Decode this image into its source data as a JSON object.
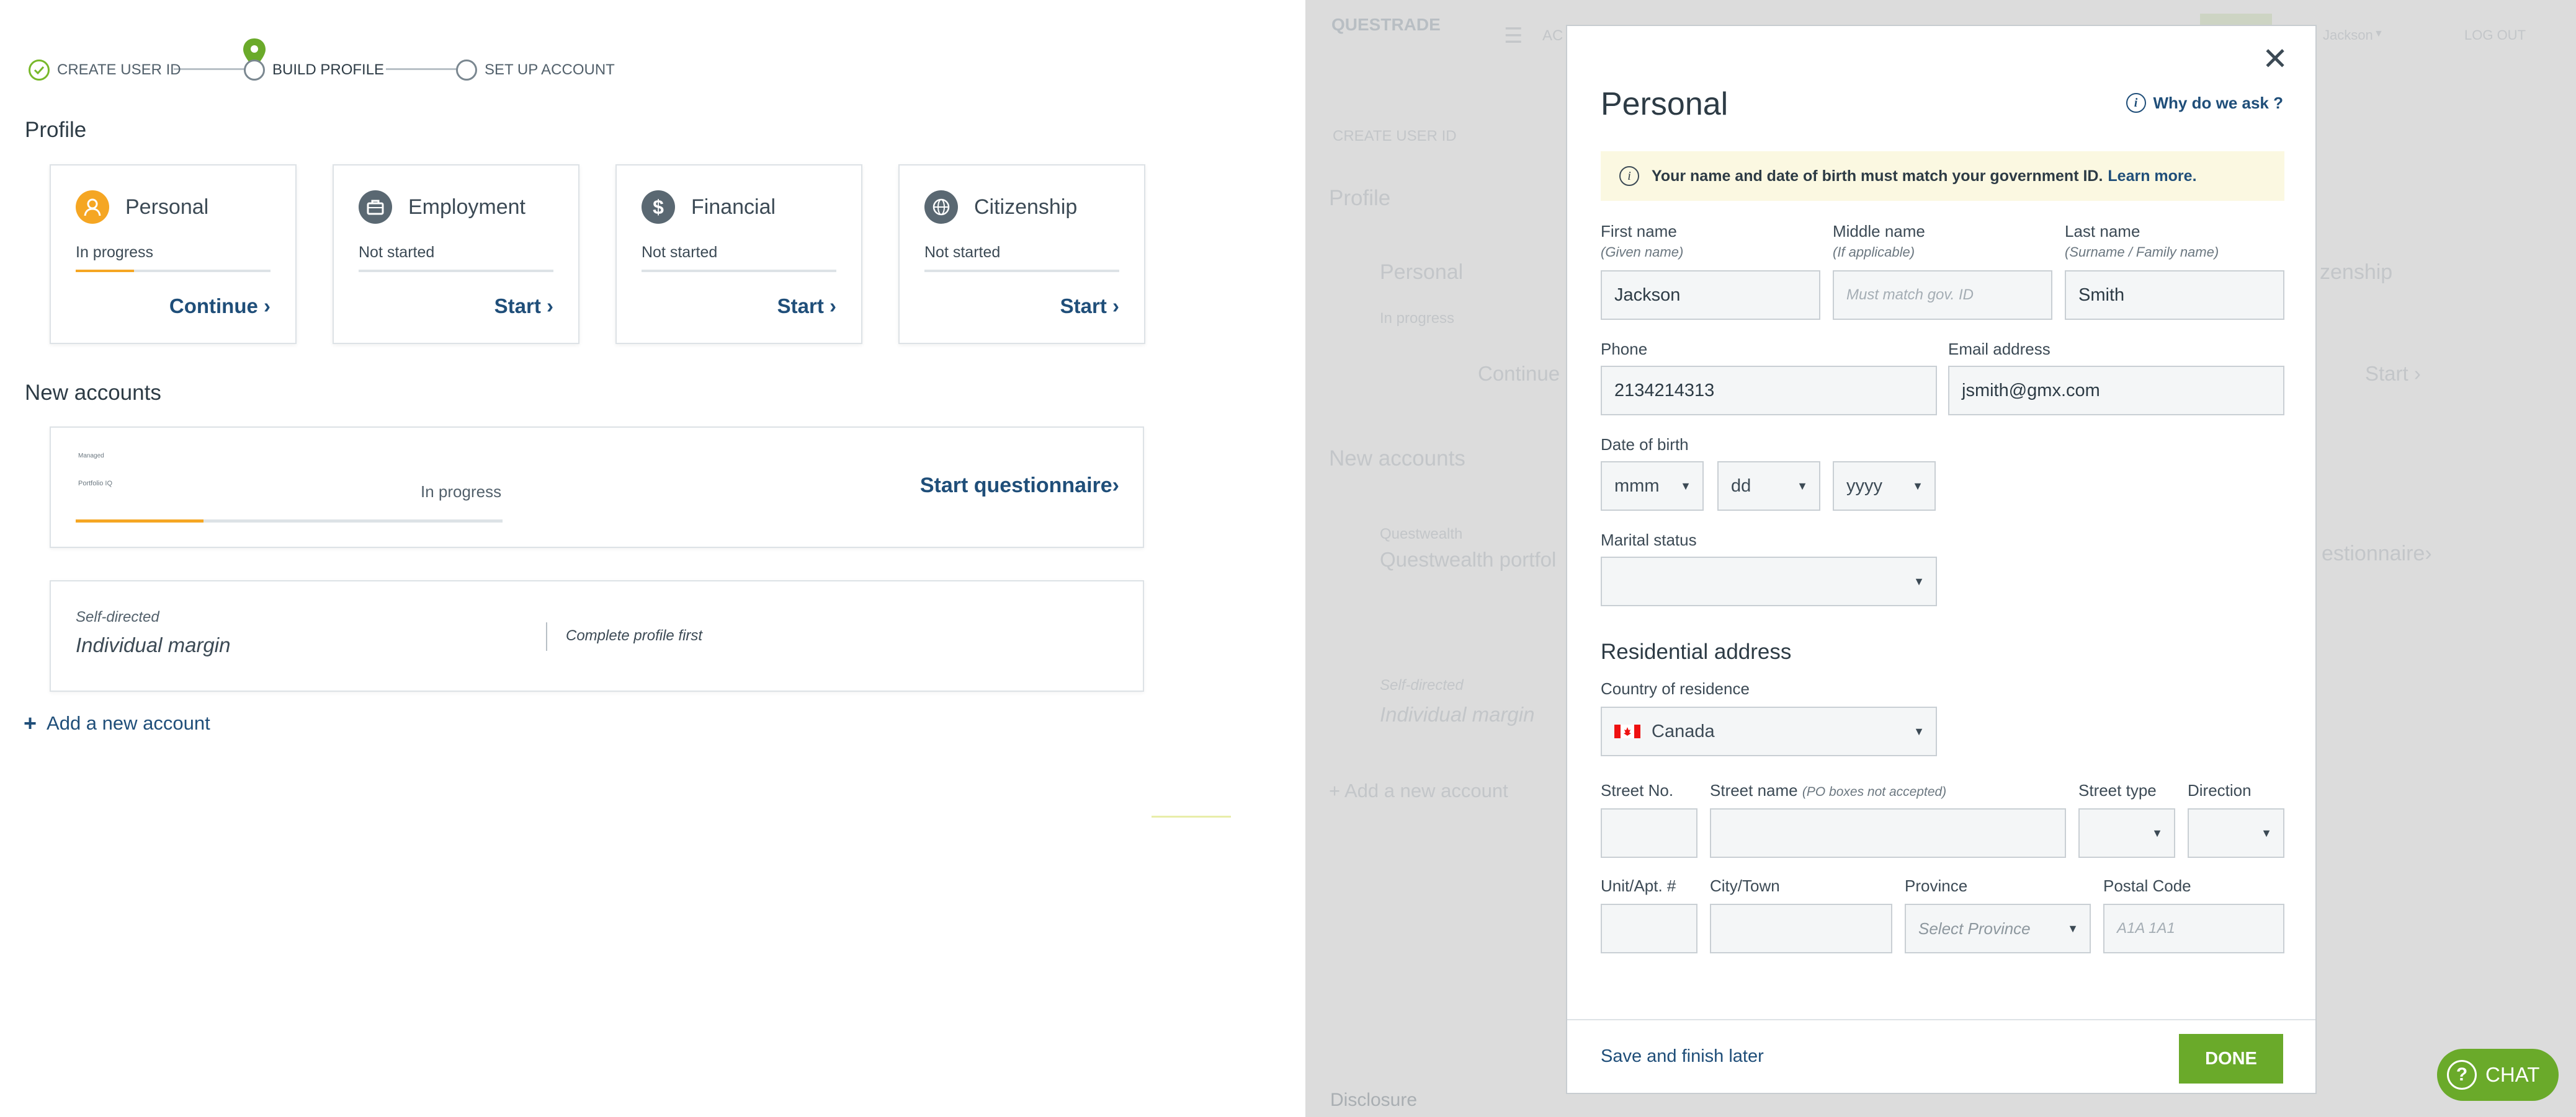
{
  "stepper": {
    "steps": [
      {
        "label": "CREATE USER ID",
        "state": "complete"
      },
      {
        "label": "BUILD PROFILE",
        "state": "current"
      },
      {
        "label": "SET UP ACCOUNT",
        "state": "pending"
      }
    ]
  },
  "profile": {
    "heading": "Profile",
    "cards": [
      {
        "title": "Personal",
        "status": "In progress",
        "progress": 0.3,
        "action": "Continue ›",
        "icon": "person-icon",
        "color": "#f5a623"
      },
      {
        "title": "Employment",
        "status": "Not started",
        "progress": 0,
        "action": "Start ›",
        "icon": "briefcase-icon",
        "color": "#5a6872"
      },
      {
        "title": "Financial",
        "status": "Not started",
        "progress": 0,
        "action": "Start ›",
        "icon": "dollar-icon",
        "color": "#5a6872"
      },
      {
        "title": "Citizenship",
        "status": "Not started",
        "progress": 0,
        "action": "Start ›",
        "icon": "globe-icon",
        "color": "#5a6872"
      }
    ]
  },
  "accounts": {
    "heading": "New accounts",
    "portfolio": {
      "tiny_top": "Managed",
      "tiny_name": "Portfolio IQ",
      "status": "In progress",
      "progress": 0.33,
      "action": "Start questionnaire›"
    },
    "selfdirected": {
      "category": "Self-directed",
      "name": "Individual margin",
      "note": "Complete profile first"
    },
    "add_link": "Add a new account"
  },
  "background": {
    "logo": "QUESTRADE",
    "nav_item": "AC",
    "user_name": "Jackson",
    "logout": "LOG OUT",
    "step1": "CREATE USER ID",
    "profile": "Profile",
    "personal": "Personal",
    "personal_status": "In progress",
    "continue": "Continue ›",
    "citizenship": "zenship",
    "start": "Start ›",
    "new_accounts": "New accounts",
    "qw_label": "Questwealth",
    "qw_name": "Questwealth portfol",
    "questionnaire": "estionnaire›",
    "sd_label": "Self-directed",
    "sd_name": "Individual margin",
    "add_account": "+ Add a new account",
    "disclosure": "Disclosure"
  },
  "modal": {
    "title": "Personal",
    "why": "Why do we ask ?",
    "notice": "Your name and date of birth must match your government ID.",
    "learn_more": "Learn more.",
    "first_name": {
      "label": "First name",
      "sub": "(Given name)",
      "value": "Jackson"
    },
    "middle_name": {
      "label": "Middle name",
      "sub": "(If applicable)",
      "placeholder": "Must match gov. ID"
    },
    "last_name": {
      "label": "Last name",
      "sub": "(Surname / Family name)",
      "value": "Smith"
    },
    "phone": {
      "label": "Phone",
      "value": "2134214313"
    },
    "email": {
      "label": "Email address",
      "value": "jsmith@gmx.com"
    },
    "dob": {
      "label": "Date of birth",
      "month": "mmm",
      "day": "dd",
      "year": "yyyy"
    },
    "marital": {
      "label": "Marital status",
      "value": ""
    },
    "address_heading": "Residential address",
    "country": {
      "label": "Country of residence",
      "value": "Canada"
    },
    "street_no": "Street No.",
    "street_name": "Street name",
    "street_name_note": "(PO boxes not accepted)",
    "street_type": "Street type",
    "direction": "Direction",
    "unit": "Unit/Apt. #",
    "city": "City/Town",
    "province": {
      "label": "Province",
      "placeholder": "Select Province"
    },
    "postal": {
      "label": "Postal Code",
      "placeholder": "A1A 1A1"
    },
    "save_later": "Save and finish later",
    "done": "DONE"
  },
  "chat": {
    "label": "CHAT"
  },
  "colors": {
    "accent_green": "#6aaa2a",
    "link_blue": "#1f4e79",
    "warning_orange": "#f5a623",
    "notice_bg": "#fbf8e1"
  }
}
